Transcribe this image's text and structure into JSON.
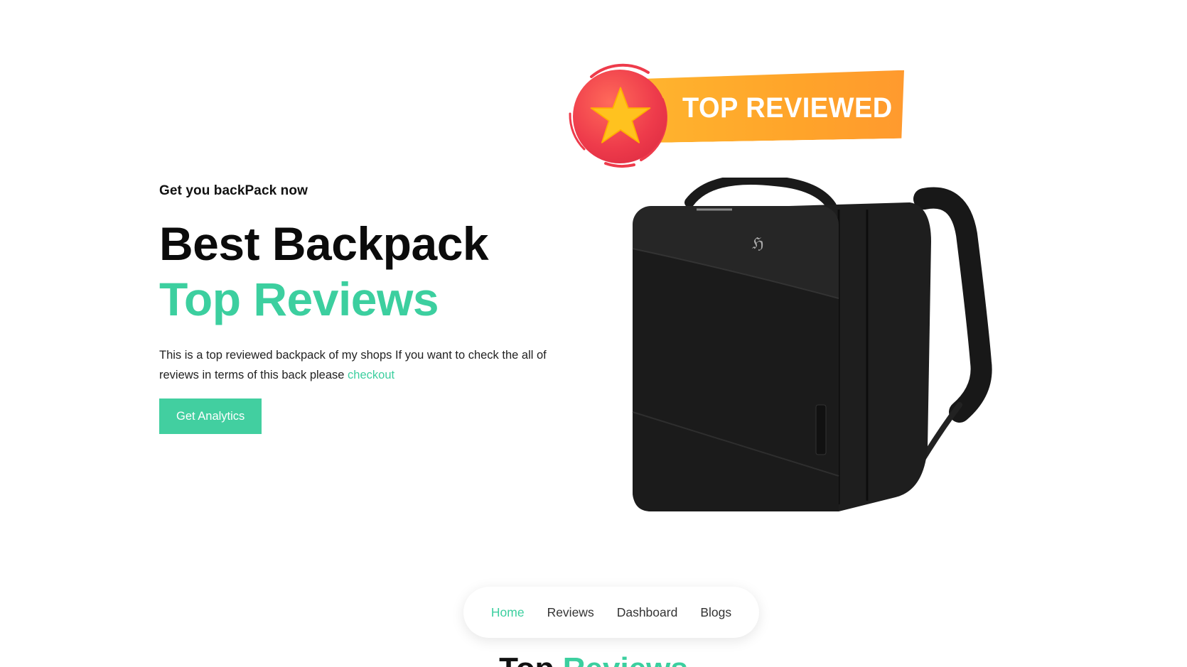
{
  "hero": {
    "eyebrow": "Get you backPack now",
    "headline_line1": "Best Backpack",
    "headline_line2": "Top Reviews",
    "description": "This is a top reviewed backpack of my shops If you want to check the all of reviews in terms of this back please",
    "description_link": "checkout",
    "cta_label": "Get Analytics"
  },
  "badge": {
    "text": "TOP REVIEWED",
    "icon": "star-icon"
  },
  "product": {
    "image": "backpack-image"
  },
  "nav": {
    "items": [
      {
        "label": "Home",
        "active": true
      },
      {
        "label": "Reviews",
        "active": false
      },
      {
        "label": "Dashboard",
        "active": false
      },
      {
        "label": "Blogs",
        "active": false
      }
    ]
  },
  "section": {
    "title_part1": "Top",
    "title_part2": "Reviews"
  },
  "colors": {
    "accent": "#3ccf9f",
    "badge_orange": "#ffa42a",
    "badge_red": "#ee3b4b"
  }
}
